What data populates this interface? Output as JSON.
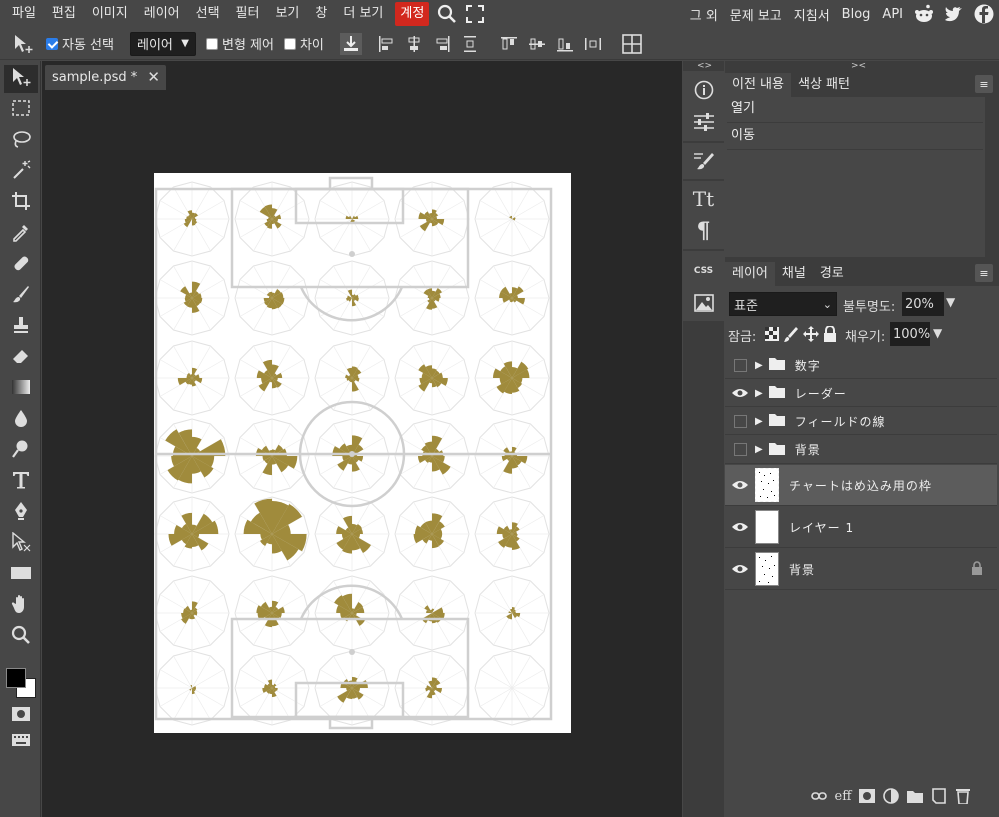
{
  "menubar": {
    "items": [
      "파일",
      "편집",
      "이미지",
      "레이어",
      "선택",
      "필터",
      "보기",
      "창",
      "더 보기"
    ],
    "account": "계정",
    "right_items": [
      "그 외",
      "문제 보고",
      "지침서",
      "Blog",
      "API"
    ]
  },
  "options": {
    "auto_select_label": "자동 선택",
    "auto_select_value": "레이어",
    "transform_label": "변형 제어",
    "diff_label": "차이"
  },
  "document": {
    "tab_title": "sample.psd *"
  },
  "mini_panel": {
    "css_label": "CSS"
  },
  "history_panel": {
    "tabs": [
      "이전 내용",
      "색상 패턴"
    ],
    "items": [
      "열기",
      "이동"
    ]
  },
  "layers_panel": {
    "tabs": [
      "레이어",
      "채널",
      "경로"
    ],
    "blend_mode": "표준",
    "opacity_label": "불투명도:",
    "opacity_value": "20%",
    "lock_label": "잠금:",
    "fill_label": "채우기:",
    "fill_value": "100%",
    "layers": [
      {
        "name": "数字",
        "type": "folder",
        "visible": false
      },
      {
        "name": "レーダー",
        "type": "folder",
        "visible": true
      },
      {
        "name": "フィールドの線",
        "type": "folder",
        "visible": false
      },
      {
        "name": "背景",
        "type": "folder",
        "visible": false
      },
      {
        "name": "チャートはめ込み用の枠",
        "type": "layer",
        "visible": true,
        "selected": true
      },
      {
        "name": "レイヤー 1",
        "type": "layer",
        "visible": true
      },
      {
        "name": "背景",
        "type": "layer",
        "visible": true,
        "locked": true
      }
    ]
  },
  "colors": {
    "accent_red": "#d2281e",
    "radar_fill": "#a08b3c"
  }
}
